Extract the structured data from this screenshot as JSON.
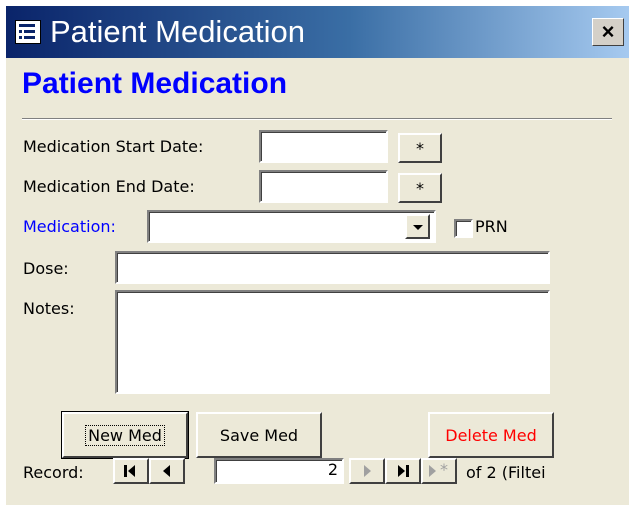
{
  "window": {
    "title": "Patient Medication",
    "close_label": "×",
    "app_icon": "form-icon"
  },
  "form": {
    "heading": "Patient Medication",
    "start_date": {
      "label": "Medication Start Date:",
      "value": "",
      "button_label": "*"
    },
    "end_date": {
      "label": "Medication End Date:",
      "value": "",
      "button_label": "*"
    },
    "medication": {
      "label": "Medication:",
      "value": "",
      "prn_label": "PRN",
      "prn_checked": false
    },
    "dose": {
      "label": "Dose:",
      "value": ""
    },
    "notes": {
      "label": "Notes:",
      "value": ""
    }
  },
  "actions": {
    "new_med": "New Med",
    "save_med": "Save Med",
    "delete_med": "Delete Med"
  },
  "navigator": {
    "label": "Record:",
    "current": "2",
    "total_text": "of  2 (Filtei"
  },
  "colors": {
    "heading": "#0000ff",
    "medication_label": "#0000ff",
    "delete_text": "#ff0000",
    "window_bg": "#ece9d8"
  }
}
